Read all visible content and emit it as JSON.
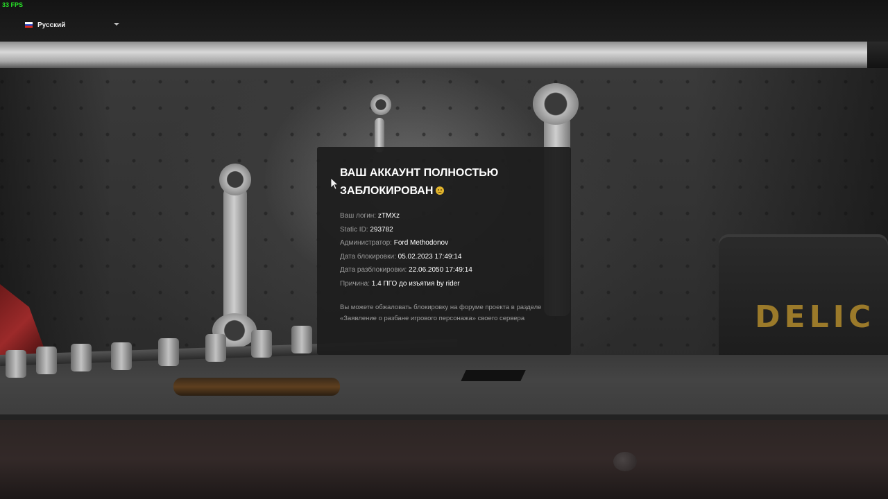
{
  "fps": "33 FPS",
  "language": {
    "selected": "Русский",
    "flag_colors": [
      "#ffffff",
      "#1c3fc7",
      "#d52b1e"
    ]
  },
  "ban": {
    "title": "ВАШ АККАУНТ ПОЛНОСТЬЮ ЗАБЛОКИРОВАН",
    "title_emoji": "sad-face-emoji",
    "login_label": "Ваш логин:",
    "login_value": "zTMXz",
    "static_label": "Static ID:",
    "static_value": "293782",
    "admin_label": "Администратор:",
    "admin_value": "Ford Methodonov",
    "ban_date_label": "Дата блокировки:",
    "ban_date_value": "05.02.2023 17:49:14",
    "unban_date_label": "Дата разблокировки:",
    "unban_date_value": "22.06.2050 17:49:14",
    "reason_label": "Причина:",
    "reason_value": "1.4 ПГО до изъятия by rider",
    "appeal_note": "Вы можете обжаловать блокировку на форуме проекта в разделе «Заявление о разбане игрового персонажа» своего сервера"
  },
  "background": {
    "toolbox_logo": "DELIC"
  },
  "colors": {
    "fps_green": "#27e027",
    "panel_bg": "#1e1e1e",
    "emoji_yellow": "#e2b52c"
  }
}
